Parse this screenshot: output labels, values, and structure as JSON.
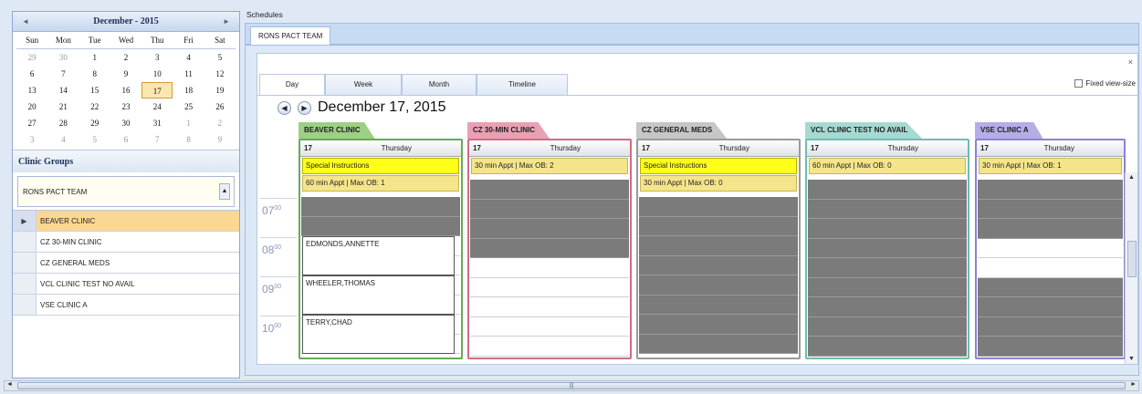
{
  "calendar": {
    "title": "December - 2015",
    "prev": "◄",
    "next": "►",
    "dow": [
      "Sun",
      "Mon",
      "Tue",
      "Wed",
      "Thu",
      "Fri",
      "Sat"
    ],
    "weeks": [
      [
        "29",
        "30",
        "1",
        "2",
        "3",
        "4",
        "5"
      ],
      [
        "6",
        "7",
        "8",
        "9",
        "10",
        "11",
        "12"
      ],
      [
        "13",
        "14",
        "15",
        "16",
        "17",
        "18",
        "19"
      ],
      [
        "20",
        "21",
        "22",
        "23",
        "24",
        "25",
        "26"
      ],
      [
        "27",
        "28",
        "29",
        "30",
        "31",
        "1",
        "2"
      ],
      [
        "3",
        "4",
        "5",
        "6",
        "7",
        "8",
        "9"
      ]
    ]
  },
  "clinic_groups": {
    "header": "Clinic Groups",
    "selected_group": "RONS PACT TEAM",
    "items": [
      "BEAVER CLINIC",
      "CZ 30-MIN CLINIC",
      "CZ GENERAL MEDS",
      "VCL CLINIC TEST NO AVAIL",
      "VSE CLINIC A"
    ]
  },
  "schedules": {
    "label": "Schedules",
    "tab": "RONS PACT TEAM",
    "close": "×",
    "views": [
      "Day",
      "Week",
      "Month",
      "Timeline"
    ],
    "fixed_view_label": "Fixed view-size",
    "date_title": "December 17, 2015",
    "times": [
      "07",
      "08",
      "09",
      "10"
    ],
    "minutes": "00",
    "columns": [
      {
        "name": "BEAVER CLINIC",
        "day": "17",
        "weekday": "Thursday",
        "instructions": "Special Instructions",
        "appt_info": "60 min Appt | Max OB: 1",
        "color": "#9dcf85",
        "border": "#6aa857",
        "appointments": [
          "EDMONDS,ANNETTE",
          "WHEELER,THOMAS",
          "TERRY,CHAD"
        ]
      },
      {
        "name": "CZ 30-MIN CLINIC",
        "day": "17",
        "weekday": "Thursday",
        "instructions": "",
        "appt_info": "30 min Appt | Max OB: 2",
        "color": "#e9a0b3",
        "border": "#d06b86"
      },
      {
        "name": "CZ GENERAL MEDS",
        "day": "17",
        "weekday": "Thursday",
        "instructions": "Special Instructions",
        "appt_info": "30 min Appt | Max OB: 0",
        "color": "#c6c6c6",
        "border": "#9a9a9a"
      },
      {
        "name": "VCL CLINIC TEST NO AVAIL",
        "day": "17",
        "weekday": "Thursday",
        "instructions": "",
        "appt_info": "60 min Appt | Max OB: 0",
        "color": "#a6d9d2",
        "border": "#6dbdb1"
      },
      {
        "name": "VSE CLINIC A",
        "day": "17",
        "weekday": "Thursday",
        "instructions": "",
        "appt_info": "30 min Appt | Max OB: 1",
        "color": "#b3aee6",
        "border": "#8a82d6"
      }
    ]
  }
}
